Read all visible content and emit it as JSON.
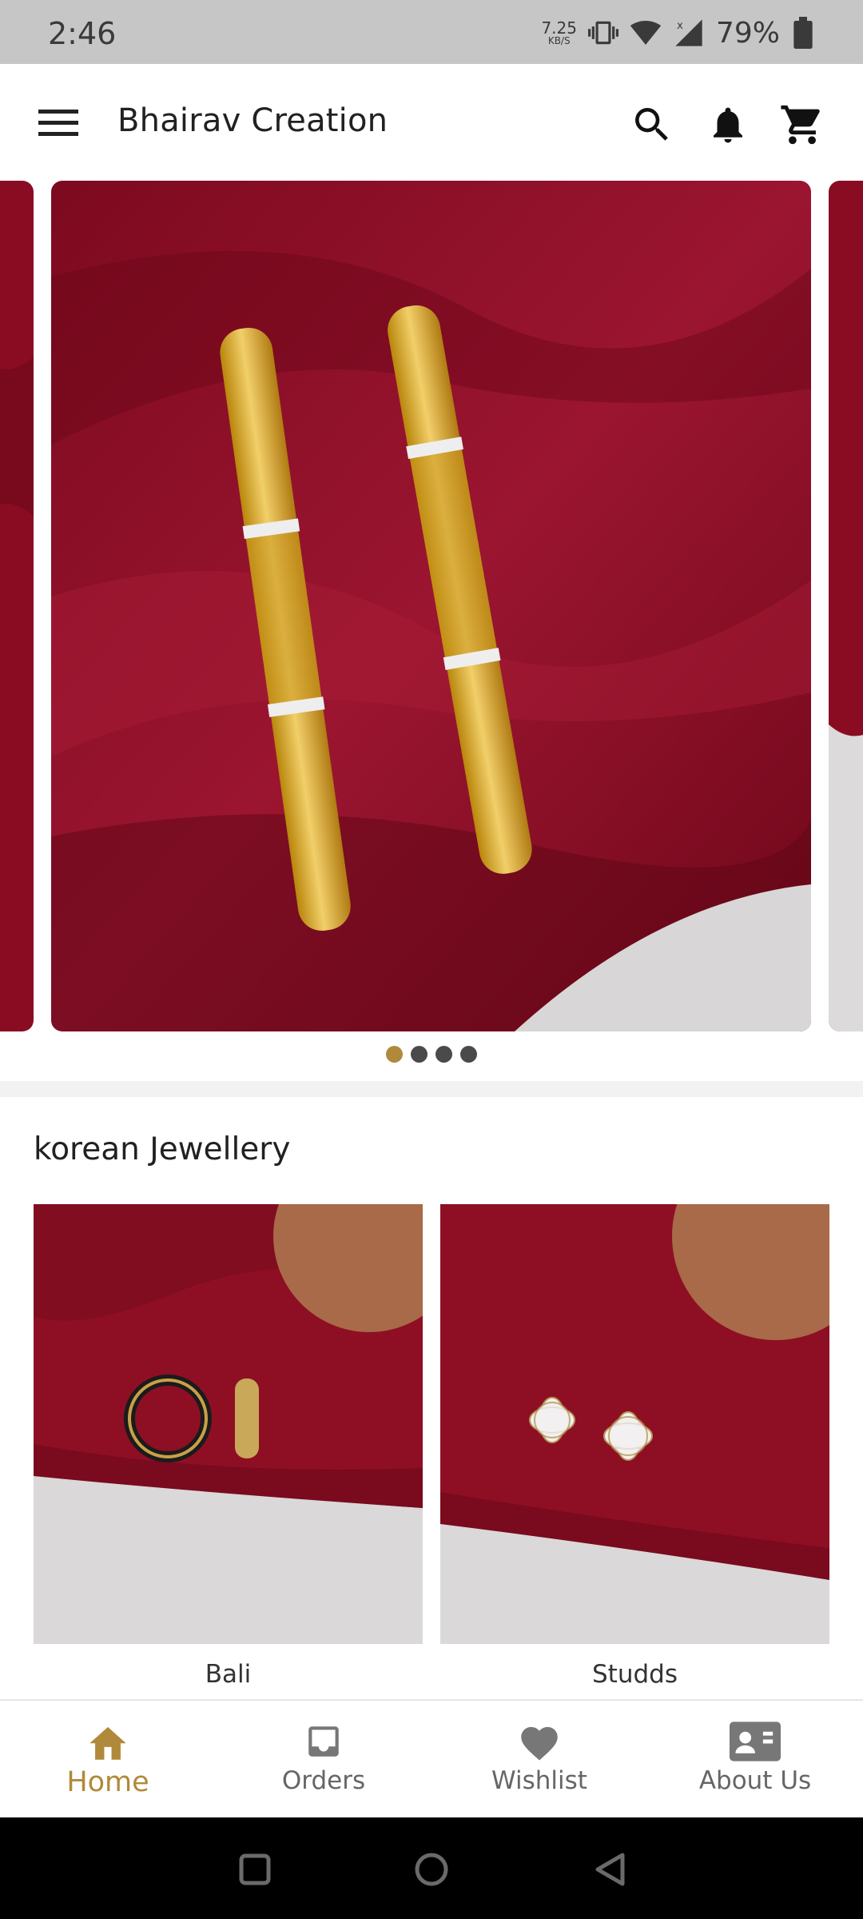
{
  "status_bar": {
    "time": "2:46",
    "net_speed_value": "7.25",
    "net_speed_unit": "KB/S",
    "battery_percent": "79%"
  },
  "app_bar": {
    "title": "Bhairav Creation",
    "icons": [
      "menu-icon",
      "search-icon",
      "bell-icon",
      "cart-icon"
    ]
  },
  "carousel": {
    "slide_count": 4,
    "active_index": 0
  },
  "section": {
    "title": "korean Jewellery",
    "products": [
      {
        "label": "Bali"
      },
      {
        "label": "Studds"
      }
    ]
  },
  "bottom_nav": {
    "items": [
      {
        "label": "Home",
        "icon": "home-icon",
        "active": true
      },
      {
        "label": "Orders",
        "icon": "inbox-icon",
        "active": false
      },
      {
        "label": "Wishlist",
        "icon": "heart-icon",
        "active": false
      },
      {
        "label": "About Us",
        "icon": "contact-card-icon",
        "active": false
      }
    ]
  },
  "colors": {
    "accent": "#b08a3a",
    "status_bar_bg": "#c6c6c6",
    "fabric_red": "#8e0f24"
  }
}
